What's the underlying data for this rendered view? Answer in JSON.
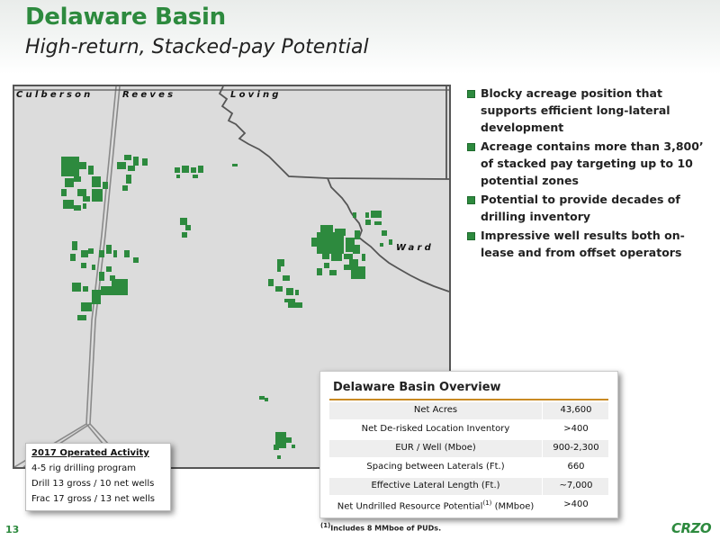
{
  "header": {
    "title": "Delaware Basin",
    "subtitle": "High-return, Stacked-pay Potential"
  },
  "map": {
    "counties": [
      "Culberson",
      "Reeves",
      "Loving",
      "Ward"
    ],
    "acreage_color": "#2d8a3e",
    "background_color": "#dcdcdc",
    "road_color": "#8a8a8a"
  },
  "bullets": [
    "Blocky acreage position that supports efficient long-lateral development",
    "Acreage contains more than 3,800’ of stacked pay targeting up to 10 potential zones",
    "Potential to provide decades of drilling inventory",
    "Impressive well results both on-lease and from offset operators"
  ],
  "overview": {
    "title": "Delaware Basin Overview",
    "rows": [
      {
        "label": "Net Acres",
        "value": "43,600"
      },
      {
        "label": "Net De-risked Location Inventory",
        "value": ">400"
      },
      {
        "label": "EUR / Well (Mboe)",
        "value": "900-2,300"
      },
      {
        "label": "Spacing between Laterals (Ft.)",
        "value": "660"
      },
      {
        "label": "Effective Lateral Length (Ft.)",
        "value": "~7,000"
      },
      {
        "label": "Net Undrilled Resource Potential",
        "label_sup": "(1)",
        "label_suffix": " (MMboe)",
        "value": ">400"
      }
    ]
  },
  "activity": {
    "title": "2017 Operated Activity",
    "lines": [
      "4-5 rig drilling program",
      "Drill  13 gross / 10 net wells",
      "Frac 17 gross / 13 net wells"
    ]
  },
  "footer": {
    "page_number": "13",
    "footnote_marker": "(1)",
    "footnote_text": "Includes 8 MMboe of PUDs.",
    "logo": "CRZO"
  },
  "colors": {
    "brand_green": "#2d8a3e",
    "accent_orange": "#c98a22"
  }
}
